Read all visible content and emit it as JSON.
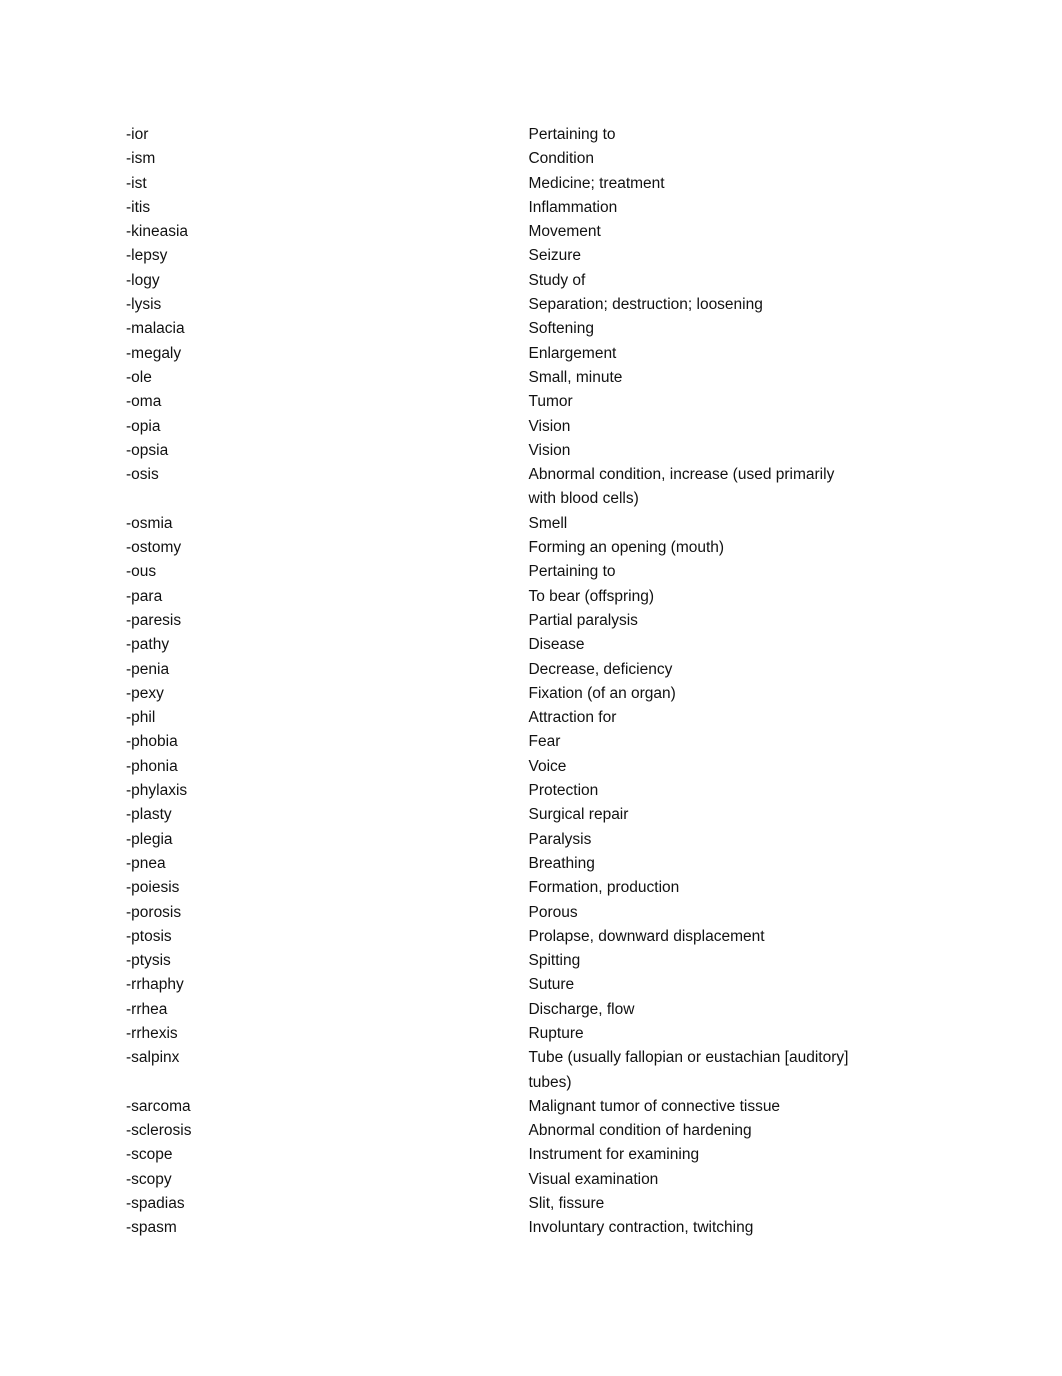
{
  "entries": [
    {
      "term": "-ior",
      "definition": [
        "Pertaining to"
      ]
    },
    {
      "term": "-ism",
      "definition": [
        "Condition"
      ]
    },
    {
      "term": "-ist",
      "definition": [
        "Medicine; treatment"
      ]
    },
    {
      "term": "-itis",
      "definition": [
        "Inflammation"
      ]
    },
    {
      "term": "-kineasia",
      "definition": [
        "Movement"
      ]
    },
    {
      "term": "-lepsy",
      "definition": [
        "Seizure"
      ]
    },
    {
      "term": "-logy",
      "definition": [
        "Study of"
      ]
    },
    {
      "term": "-lysis",
      "definition": [
        "Separation; destruction; loosening"
      ]
    },
    {
      "term": "-malacia",
      "definition": [
        "Softening"
      ]
    },
    {
      "term": "-megaly",
      "definition": [
        "Enlargement"
      ]
    },
    {
      "term": "-ole",
      "definition": [
        "Small, minute"
      ]
    },
    {
      "term": "-oma",
      "definition": [
        "Tumor"
      ]
    },
    {
      "term": "-opia",
      "definition": [
        "Vision"
      ]
    },
    {
      "term": "-opsia",
      "definition": [
        "Vision"
      ]
    },
    {
      "term": "-osis",
      "definition": [
        "Abnormal condition, increase (used primarily",
        "with blood cells)"
      ]
    },
    {
      "term": "-osmia",
      "definition": [
        "Smell"
      ]
    },
    {
      "term": "-ostomy",
      "definition": [
        "Forming an opening (mouth)"
      ]
    },
    {
      "term": "-ous",
      "definition": [
        "Pertaining to"
      ]
    },
    {
      "term": "-para",
      "definition": [
        "To bear (offspring)"
      ]
    },
    {
      "term": "-paresis",
      "definition": [
        "Partial paralysis"
      ]
    },
    {
      "term": "-pathy",
      "definition": [
        "Disease"
      ]
    },
    {
      "term": "-penia",
      "definition": [
        "Decrease, deficiency"
      ]
    },
    {
      "term": "-pexy",
      "definition": [
        "Fixation (of an organ)"
      ]
    },
    {
      "term": "-phil",
      "definition": [
        "Attraction for"
      ]
    },
    {
      "term": "-phobia",
      "definition": [
        "Fear"
      ]
    },
    {
      "term": "-phonia",
      "definition": [
        "Voice"
      ]
    },
    {
      "term": "-phylaxis",
      "definition": [
        "Protection"
      ]
    },
    {
      "term": "-plasty",
      "definition": [
        "Surgical repair"
      ]
    },
    {
      "term": "-plegia",
      "definition": [
        "Paralysis"
      ]
    },
    {
      "term": "-pnea",
      "definition": [
        "Breathing"
      ]
    },
    {
      "term": "-poiesis",
      "definition": [
        "Formation, production"
      ]
    },
    {
      "term": "-porosis",
      "definition": [
        "Porous"
      ]
    },
    {
      "term": "-ptosis",
      "definition": [
        "Prolapse, downward displacement"
      ]
    },
    {
      "term": "-ptysis",
      "definition": [
        "Spitting"
      ]
    },
    {
      "term": "-rrhaphy",
      "definition": [
        "Suture"
      ]
    },
    {
      "term": "-rrhea",
      "definition": [
        "Discharge, flow"
      ]
    },
    {
      "term": "-rrhexis",
      "definition": [
        "Rupture"
      ]
    },
    {
      "term": "-salpinx",
      "definition": [
        "Tube (usually fallopian or eustachian [auditory]",
        "tubes)"
      ]
    },
    {
      "term": "-sarcoma",
      "definition": [
        "Malignant tumor of connective tissue"
      ]
    },
    {
      "term": "-sclerosis",
      "definition": [
        "Abnormal condition of hardening"
      ]
    },
    {
      "term": "-scope",
      "definition": [
        "Instrument for examining"
      ]
    },
    {
      "term": "-scopy",
      "definition": [
        "Visual examination"
      ]
    },
    {
      "term": "-spadias",
      "definition": [
        "Slit, fissure"
      ]
    },
    {
      "term": "-spasm",
      "definition": [
        "Involuntary contraction, twitching"
      ]
    }
  ]
}
